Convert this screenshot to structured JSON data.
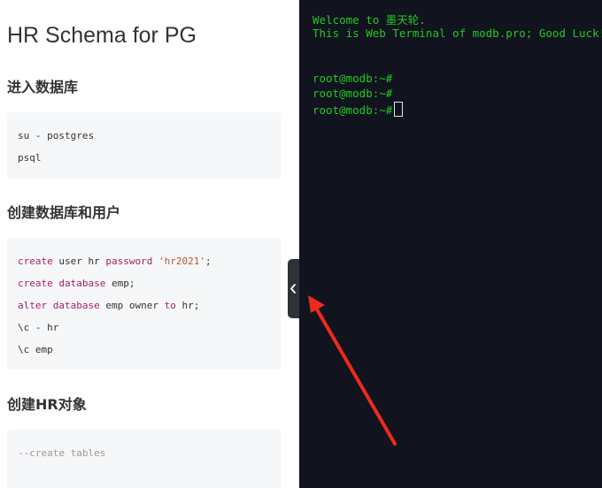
{
  "doc": {
    "title": "HR Schema for PG",
    "sections": [
      {
        "heading": "进入数据库",
        "lines": [
          "su - postgres",
          "psql"
        ]
      },
      {
        "heading": "创建数据库和用户",
        "lines": [
          {
            "parts": [
              [
                "create",
                "kw"
              ],
              [
                " user ",
                ""
              ],
              [
                "hr",
                ""
              ],
              [
                " ",
                ""
              ],
              [
                "password",
                "kw"
              ],
              [
                " ",
                ""
              ],
              [
                "'hr2021'",
                "str"
              ],
              [
                ";",
                ""
              ]
            ]
          },
          {
            "parts": [
              [
                "create",
                "kw"
              ],
              [
                " ",
                ""
              ],
              [
                "database",
                "kw"
              ],
              [
                " emp;",
                ""
              ]
            ]
          },
          {
            "parts": [
              [
                "alter",
                "kw"
              ],
              [
                " ",
                ""
              ],
              [
                "database",
                "kw"
              ],
              [
                " emp owner ",
                ""
              ],
              [
                "to",
                "kw"
              ],
              [
                " hr;",
                ""
              ]
            ]
          },
          "\\c - hr",
          "\\c emp"
        ]
      },
      {
        "heading": "创建HR对象",
        "lines": [
          "--create tables"
        ]
      }
    ]
  },
  "code": {
    "s2_l1": {
      "a": "create",
      "b": " user hr ",
      "c": "password",
      "d": " ",
      "e": "'hr2021'",
      "f": ";"
    },
    "s2_l2": {
      "a": "create",
      "b": " ",
      "c": "database",
      "d": " emp;"
    },
    "s2_l3": {
      "a": "alter",
      "b": " ",
      "c": "database",
      "d": " emp owner ",
      "e": "to",
      "f": " hr;"
    }
  },
  "terminal": {
    "welcome": "Welcome to 墨天轮.",
    "info": "This is Web Terminal of modb.pro; Good Luck!",
    "prompts": [
      "root@modb:~#",
      "root@modb:~#",
      "root@modb:~#"
    ]
  },
  "colors": {
    "terminal_bg": "#11131f",
    "terminal_text": "#22c922",
    "keyword": "#a3226b",
    "string": "#b35a2b",
    "annotation": "#ee2a1c"
  },
  "icons": {
    "collapse": "chevron-left-icon",
    "annotation": "red-arrow"
  }
}
